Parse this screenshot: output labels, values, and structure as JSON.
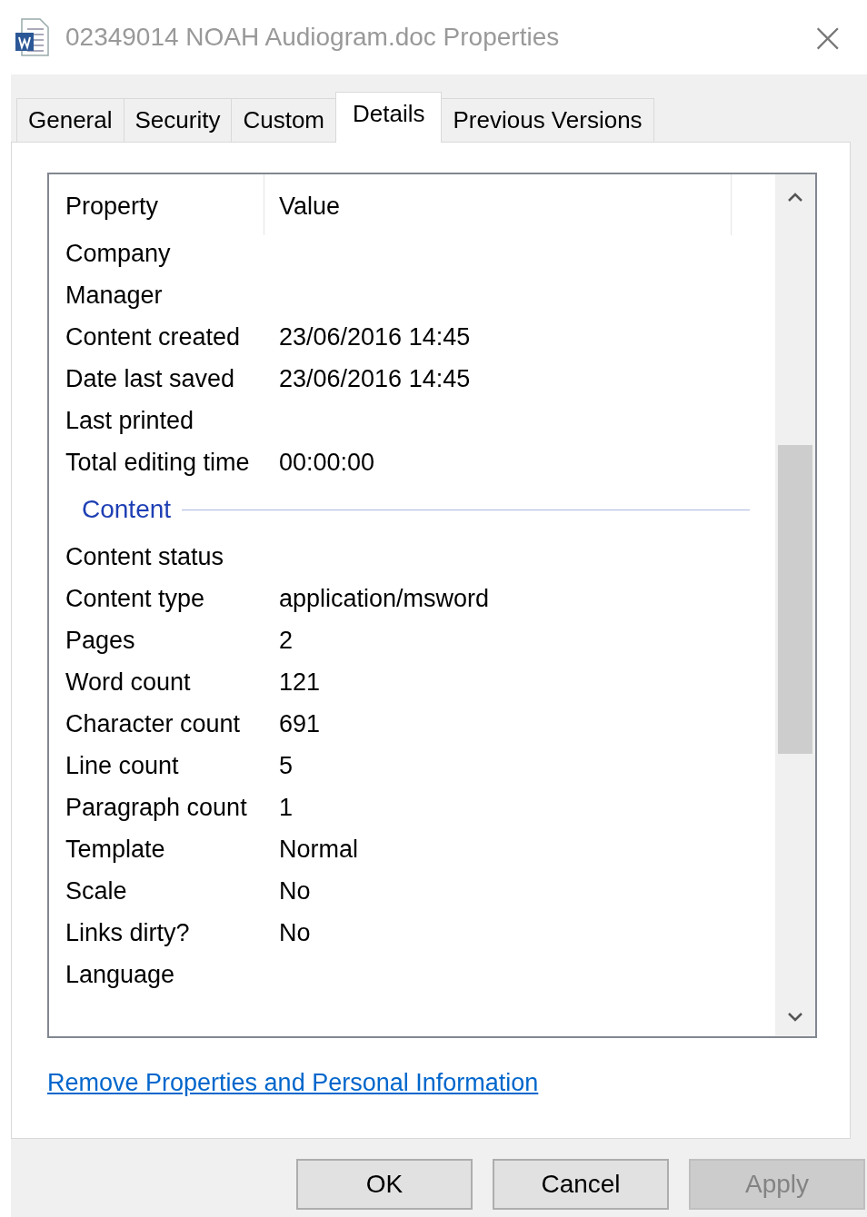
{
  "window": {
    "title": "02349014 NOAH Audiogram.doc Properties",
    "close": "×"
  },
  "tabs": [
    {
      "label": "General",
      "selected": false
    },
    {
      "label": "Security",
      "selected": false
    },
    {
      "label": "Custom",
      "selected": false
    },
    {
      "label": "Details",
      "selected": true
    },
    {
      "label": "Previous Versions",
      "selected": false
    }
  ],
  "table": {
    "columns": [
      "Property",
      "Value"
    ],
    "rows": [
      {
        "kind": "row",
        "property": "Company",
        "value": ""
      },
      {
        "kind": "row",
        "property": "Manager",
        "value": ""
      },
      {
        "kind": "row",
        "property": "Content created",
        "value": "23/06/2016 14:45"
      },
      {
        "kind": "row",
        "property": "Date last saved",
        "value": "23/06/2016 14:45"
      },
      {
        "kind": "row",
        "property": "Last printed",
        "value": ""
      },
      {
        "kind": "row",
        "property": "Total editing time",
        "value": "00:00:00"
      },
      {
        "kind": "group",
        "property": "Content"
      },
      {
        "kind": "row",
        "property": "Content status",
        "value": ""
      },
      {
        "kind": "row",
        "property": "Content type",
        "value": "application/msword"
      },
      {
        "kind": "row",
        "property": "Pages",
        "value": "2"
      },
      {
        "kind": "row",
        "property": "Word count",
        "value": "121"
      },
      {
        "kind": "row",
        "property": "Character count",
        "value": "691"
      },
      {
        "kind": "row",
        "property": "Line count",
        "value": "5"
      },
      {
        "kind": "row",
        "property": "Paragraph count",
        "value": "1"
      },
      {
        "kind": "row",
        "property": "Template",
        "value": "Normal"
      },
      {
        "kind": "row",
        "property": "Scale",
        "value": "No"
      },
      {
        "kind": "row",
        "property": "Links dirty?",
        "value": "No"
      },
      {
        "kind": "row",
        "property": "Language",
        "value": ""
      }
    ]
  },
  "link": "Remove Properties and Personal Information",
  "buttons": [
    {
      "label": "OK",
      "disabled": false
    },
    {
      "label": "Cancel",
      "disabled": false
    },
    {
      "label": "Apply",
      "disabled": true
    }
  ]
}
